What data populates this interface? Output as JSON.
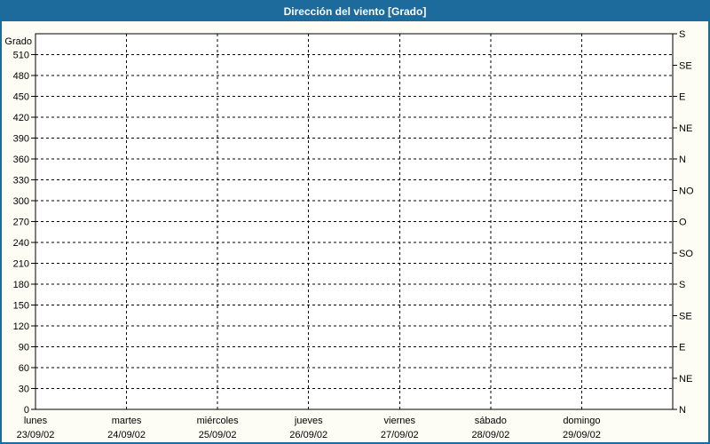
{
  "title_bar": {
    "title": "Dirección del viento [Grado]",
    "bg_color": "#1d6a9c",
    "text_color": "#ffffff"
  },
  "colors": {
    "window_bg": "#fdfdf5",
    "plot_bg": "#ffffff",
    "grid": "#000000",
    "axis": "#000000",
    "text": "#000000",
    "border": "#1d6a9c"
  },
  "chart_data": {
    "type": "line",
    "title": "Dirección del viento [Grado]",
    "ylabel": "Grado",
    "ylim": [
      0,
      540
    ],
    "grid": "dashed",
    "legend": "none",
    "y_ticks_left": [
      0,
      30,
      60,
      90,
      120,
      150,
      180,
      210,
      240,
      270,
      300,
      330,
      360,
      390,
      420,
      450,
      480,
      510
    ],
    "y_ticks_right": [
      {
        "deg": 0,
        "label": "N"
      },
      {
        "deg": 45,
        "label": "NE"
      },
      {
        "deg": 90,
        "label": "E"
      },
      {
        "deg": 135,
        "label": "SE"
      },
      {
        "deg": 180,
        "label": "S"
      },
      {
        "deg": 225,
        "label": "SO"
      },
      {
        "deg": 270,
        "label": "O"
      },
      {
        "deg": 315,
        "label": "NO"
      },
      {
        "deg": 360,
        "label": "N"
      },
      {
        "deg": 405,
        "label": "NE"
      },
      {
        "deg": 450,
        "label": "E"
      },
      {
        "deg": 495,
        "label": "SE"
      },
      {
        "deg": 540,
        "label": "S"
      }
    ],
    "x_categories": [
      {
        "day": "lunes",
        "date": "23/09/02"
      },
      {
        "day": "martes",
        "date": "24/09/02"
      },
      {
        "day": "miércoles",
        "date": "25/09/02"
      },
      {
        "day": "jueves",
        "date": "26/09/02"
      },
      {
        "day": "viernes",
        "date": "27/09/02"
      },
      {
        "day": "sábado",
        "date": "28/09/02"
      },
      {
        "day": "domingo",
        "date": "29/09/02"
      }
    ],
    "series": []
  }
}
